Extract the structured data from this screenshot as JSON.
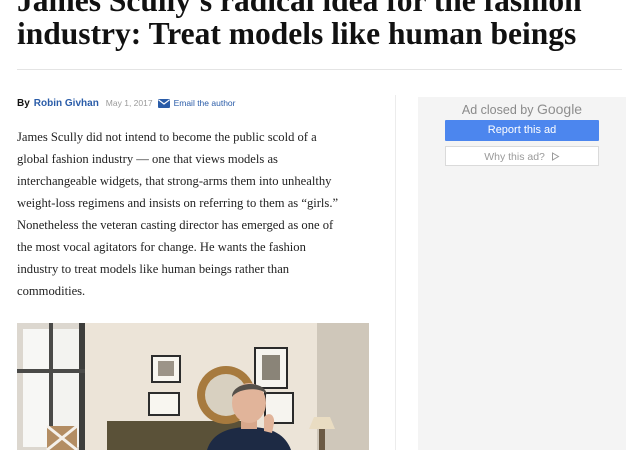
{
  "article": {
    "headline_line1": "James Scully's radical idea for the fashion",
    "headline_line2": "industry: Treat models like human beings",
    "byline": {
      "prefix": "By",
      "author": "Robin Givhan",
      "date": "May 1, 2017",
      "email_label": "Email the author",
      "icon": "mail-icon"
    },
    "body_lines": [
      "James Scully did not intend to become the public scold of a",
      "global fashion industry — one that views models as",
      "interchangeable widgets, that strong-arms them into unhealthy",
      "weight-loss regimens and insists on referring to them as “girls.”",
      "Nonetheless the veteran casting director has emerged as one of",
      "the most vocal agitators for change. He wants the fashion",
      "industry to treat models like human beings rather than",
      "commodities."
    ]
  },
  "ad": {
    "closed_prefix": "Ad closed by",
    "closed_brand": "Google",
    "report_label": "Report this ad",
    "why_label": "Why this ad?",
    "why_icon": "play-outline-icon",
    "colors": {
      "report_button": "#4c86ee",
      "panel": "#f4f4f4"
    }
  },
  "colors": {
    "link": "#2a5ca8",
    "text": "#222222"
  }
}
